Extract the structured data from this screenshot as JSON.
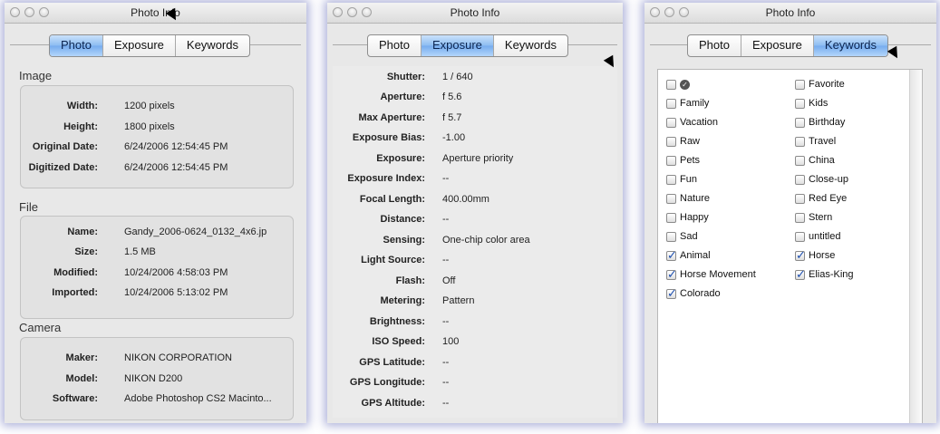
{
  "windows": [
    {
      "title": "Photo Info",
      "tabs": [
        "Photo",
        "Exposure",
        "Keywords"
      ],
      "active_tab": "Photo",
      "groups": [
        {
          "title": "Image",
          "rows": [
            {
              "label": "Width:",
              "value": "1200 pixels"
            },
            {
              "label": "Height:",
              "value": "1800 pixels"
            },
            {
              "label": "Original Date:",
              "value": "6/24/2006 12:54:45 PM"
            },
            {
              "label": "Digitized Date:",
              "value": "6/24/2006 12:54:45 PM"
            }
          ]
        },
        {
          "title": "File",
          "rows": [
            {
              "label": "Name:",
              "value": "Gandy_2006-0624_0132_4x6.jp"
            },
            {
              "label": "Size:",
              "value": "1.5 MB"
            },
            {
              "label": "Modified:",
              "value": "10/24/2006 4:58:03 PM"
            },
            {
              "label": "Imported:",
              "value": "10/24/2006 5:13:02 PM"
            }
          ]
        },
        {
          "title": "Camera",
          "rows": [
            {
              "label": "Maker:",
              "value": "NIKON CORPORATION"
            },
            {
              "label": "Model:",
              "value": "NIKON D200"
            },
            {
              "label": "Software:",
              "value": "Adobe Photoshop CS2 Macinto..."
            }
          ]
        }
      ]
    },
    {
      "title": "Photo Info",
      "tabs": [
        "Photo",
        "Exposure",
        "Keywords"
      ],
      "active_tab": "Exposure",
      "rows": [
        {
          "label": "Shutter:",
          "value": "1 / 640"
        },
        {
          "label": "Aperture:",
          "value": "f 5.6"
        },
        {
          "label": "Max Aperture:",
          "value": "f 5.7"
        },
        {
          "label": "Exposure Bias:",
          "value": "-1.00"
        },
        {
          "label": "Exposure:",
          "value": "Aperture priority"
        },
        {
          "label": "Exposure Index:",
          "value": "--"
        },
        {
          "label": "Focal Length:",
          "value": "400.00mm"
        },
        {
          "label": "Distance:",
          "value": "--"
        },
        {
          "label": "Sensing:",
          "value": "One-chip color area"
        },
        {
          "label": "Light Source:",
          "value": "--"
        },
        {
          "label": "Flash:",
          "value": "Off"
        },
        {
          "label": "Metering:",
          "value": "Pattern"
        },
        {
          "label": "Brightness:",
          "value": "--"
        },
        {
          "label": "ISO Speed:",
          "value": "100"
        },
        {
          "label": "GPS Latitude:",
          "value": "--"
        },
        {
          "label": "GPS Longitude:",
          "value": "--"
        },
        {
          "label": "GPS Altitude:",
          "value": "--"
        }
      ]
    },
    {
      "title": "Photo Info",
      "tabs": [
        "Photo",
        "Exposure",
        "Keywords"
      ],
      "active_tab": "Keywords",
      "keywords_left": [
        {
          "label": "",
          "checked": false,
          "icon": "checkmark-badge-icon"
        },
        {
          "label": "Family",
          "checked": false
        },
        {
          "label": "Vacation",
          "checked": false
        },
        {
          "label": "Raw",
          "checked": false
        },
        {
          "label": "Pets",
          "checked": false
        },
        {
          "label": "Fun",
          "checked": false
        },
        {
          "label": "Nature",
          "checked": false
        },
        {
          "label": "Happy",
          "checked": false
        },
        {
          "label": "Sad",
          "checked": false
        },
        {
          "label": "Animal",
          "checked": true
        },
        {
          "label": "Horse Movement",
          "checked": true
        },
        {
          "label": "Colorado",
          "checked": true
        }
      ],
      "keywords_right": [
        {
          "label": "Favorite",
          "checked": false
        },
        {
          "label": "Kids",
          "checked": false
        },
        {
          "label": "Birthday",
          "checked": false
        },
        {
          "label": "Travel",
          "checked": false
        },
        {
          "label": "China",
          "checked": false
        },
        {
          "label": "Close-up",
          "checked": false
        },
        {
          "label": "Red Eye",
          "checked": false
        },
        {
          "label": "Stern",
          "checked": false
        },
        {
          "label": "untitled",
          "checked": false
        },
        {
          "label": "Horse",
          "checked": true
        },
        {
          "label": "Elias-King",
          "checked": true
        }
      ]
    }
  ],
  "colors": {
    "active_tab": "#8cbcf1",
    "window_glow": "#4650aa",
    "checkmark": "#1d4fb0"
  }
}
